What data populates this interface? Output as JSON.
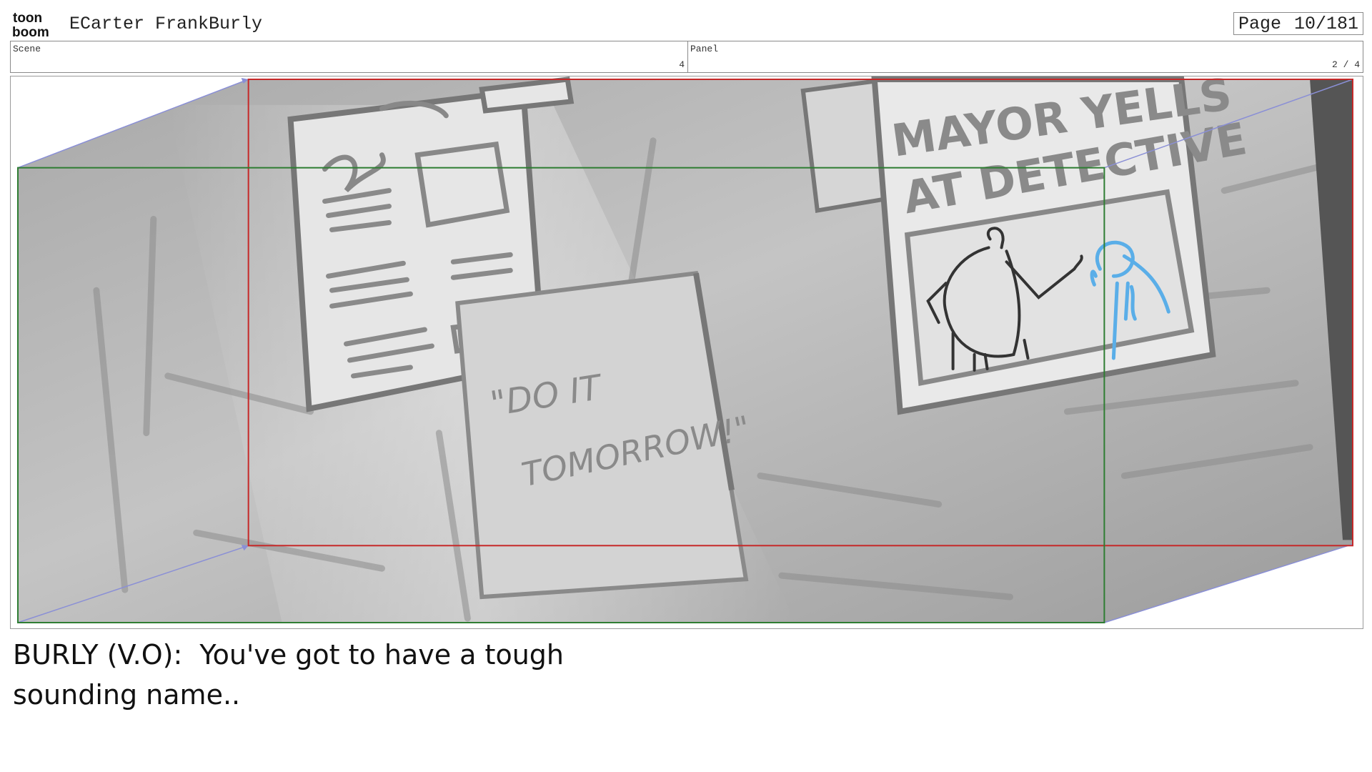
{
  "header": {
    "logo": {
      "line1": "toon",
      "line2": "boom"
    },
    "project_title": "ECarter FrankBurly",
    "page_label": "Page",
    "page_value": "10/181"
  },
  "info": {
    "scene_label": "Scene",
    "scene_value": "4",
    "panel_label": "Panel",
    "panel_value": "2 / 4"
  },
  "sketch": {
    "headline_line1": "MAYOR YELLS",
    "headline_line2": "AT DETECTIVE",
    "note_line1": "\"DO IT",
    "note_line2": "TOMORROW!\"",
    "camera_frame_colors": {
      "start": "#2e7d32",
      "end": "#c62828",
      "path": "#8a8fd6",
      "highlight": "#5aaee8"
    }
  },
  "dialogue": "BURLY (V.O):  You've got to have a tough\nsounding name.."
}
